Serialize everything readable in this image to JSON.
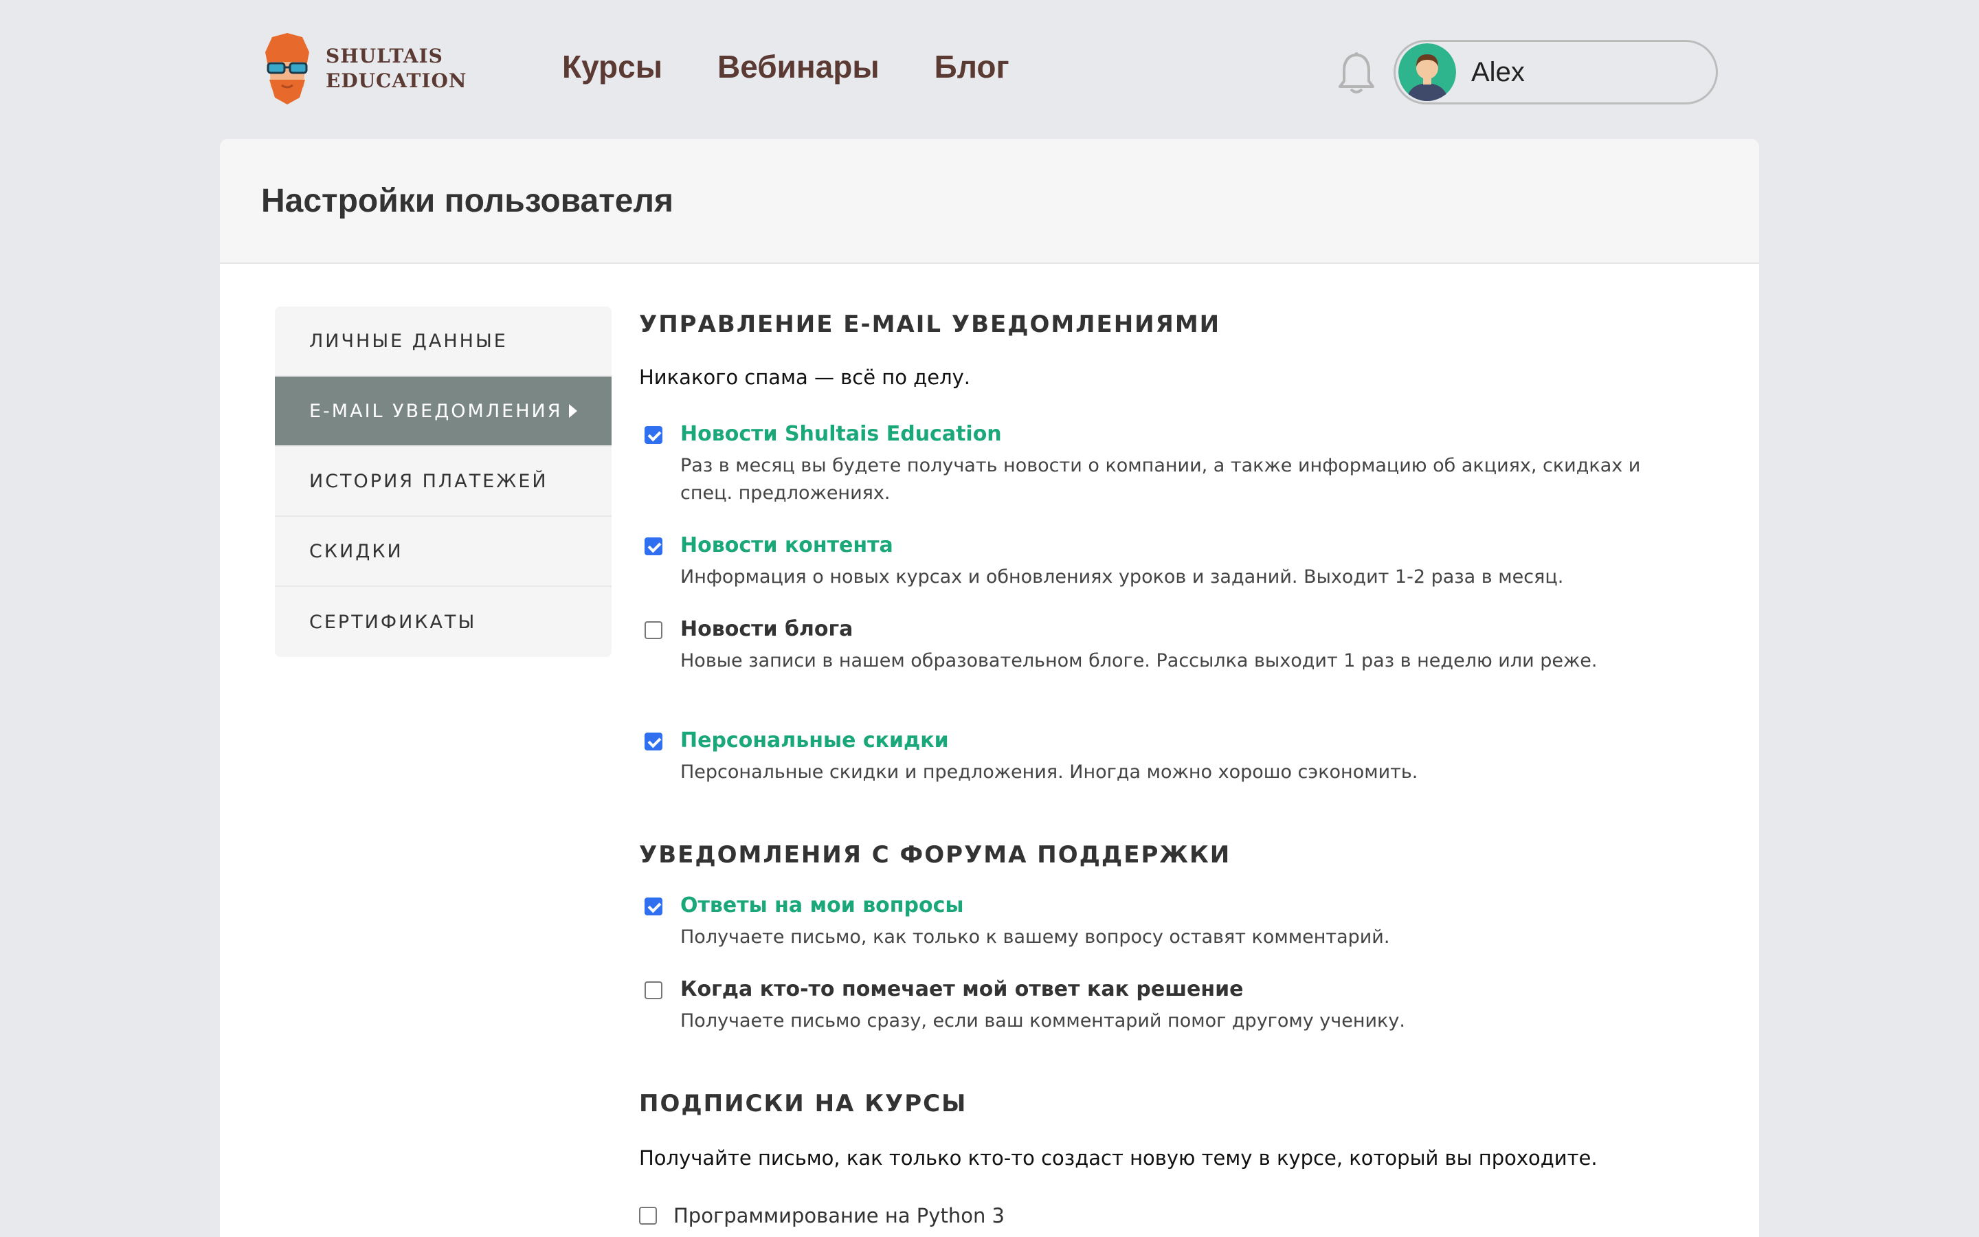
{
  "brand": {
    "line1": "SHULTAIS",
    "line2": "EDUCATION"
  },
  "nav": {
    "items": [
      {
        "label": "Курсы"
      },
      {
        "label": "Вебинары"
      },
      {
        "label": "Блог"
      }
    ]
  },
  "user": {
    "name": "Alex"
  },
  "page": {
    "title": "Настройки пользователя"
  },
  "sidebar": {
    "items": [
      {
        "label": "ЛИЧНЫЕ ДАННЫЕ",
        "active": false
      },
      {
        "label": "E-MAIL УВЕДОМЛЕНИЯ",
        "active": true
      },
      {
        "label": "ИСТОРИЯ ПЛАТЕЖЕЙ",
        "active": false
      },
      {
        "label": "СКИДКИ",
        "active": false
      },
      {
        "label": "СЕРТИФИКАТЫ",
        "active": false
      }
    ]
  },
  "email": {
    "title": "УПРАВЛЕНИЕ E-MAIL УВЕДОМЛЕНИЯМИ",
    "description": "Никакого спама — всё по делу.",
    "options": [
      {
        "title": "Новости Shultais Education",
        "checked": true,
        "description": "Раз в месяц вы будете получать новости о компании, а также информацию об акциях, скидках и спец. предложениях."
      },
      {
        "title": "Новости контента",
        "checked": true,
        "description": "Информация о новых курсах и обновлениях уроков и заданий. Выходит 1-2 раза в месяц."
      },
      {
        "title": "Новости блога",
        "checked": false,
        "description": "Новые записи в нашем образовательном блоге. Рассылка выходит 1 раз в неделю или реже."
      },
      {
        "title": "Персональные скидки",
        "checked": true,
        "description": "Персональные скидки и предложения. Иногда можно хорошо сэкономить."
      }
    ]
  },
  "forum": {
    "title": "УВЕДОМЛЕНИЯ С ФОРУМА ПОДДЕРЖКИ",
    "options": [
      {
        "title": "Ответы на мои вопросы",
        "checked": true,
        "description": "Получаете письмо, как только к вашему вопросу оставят комментарий."
      },
      {
        "title": "Когда кто-то помечает мой ответ как решение",
        "checked": false,
        "description": "Получаете письмо сразу, если ваш комментарий помог другому ученику."
      }
    ]
  },
  "courses": {
    "title": "ПОДПИСКИ НА КУРСЫ",
    "description": "Получайте письмо, как только кто-то создаст новую тему в курсе, который вы проходите.",
    "items": [
      {
        "label": "Программирование на Python 3",
        "checked": false
      }
    ]
  },
  "colors": {
    "brand": "#5c3a34",
    "accent_green": "#1aa77a",
    "checkbox_blue": "#2f6ff0",
    "sidebar_active": "#7b8785"
  }
}
